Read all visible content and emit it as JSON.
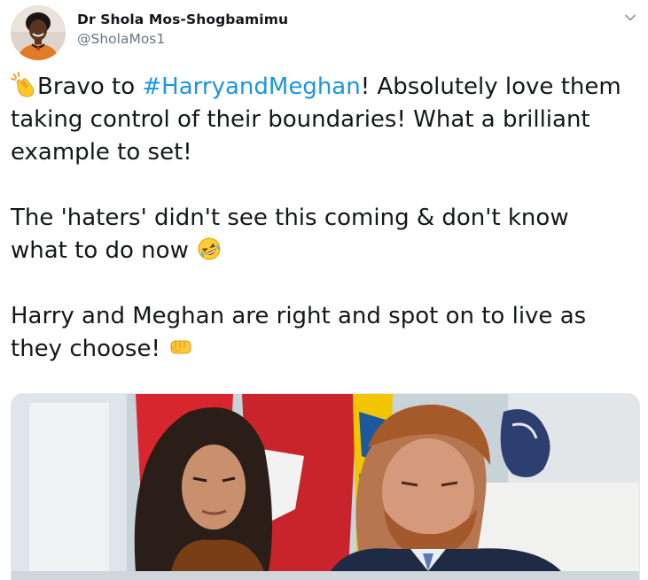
{
  "author": {
    "display_name": "Dr Shola Mos-Shogbamimu",
    "handle": "@SholaMos1"
  },
  "tweet": {
    "para1_before": "Bravo to ",
    "hashtag": "#HarryandMeghan",
    "para1_after": "! Absolutely love them taking control of their boundaries! What a brilliant example to set!",
    "para2": "The 'haters' didn't see this coming & don't know what to do now ",
    "para3": "Harry and Meghan are right and spot on to live as they choose! "
  },
  "icons": {
    "menu": "chevron-down-icon",
    "emoji1": "clapping-hands-emoji",
    "emoji2": "rolling-on-floor-laughing-emoji",
    "emoji3": "oncoming-fist-emoji"
  },
  "colors": {
    "hashtag": "#1b95e0",
    "handle": "#657786",
    "text": "#14171a"
  }
}
